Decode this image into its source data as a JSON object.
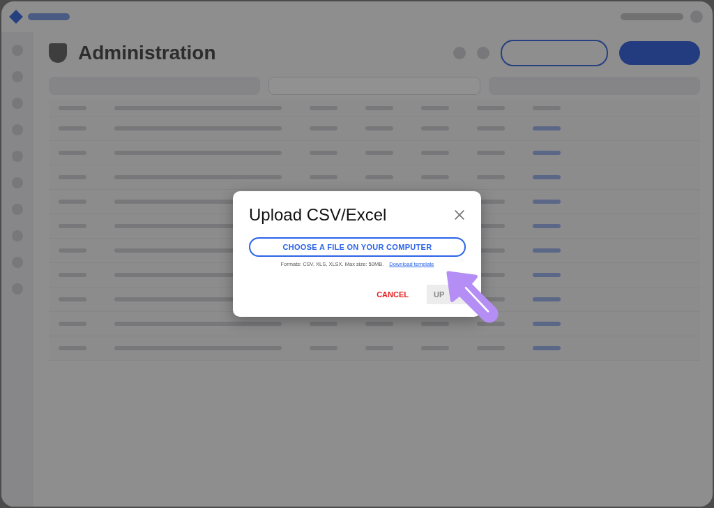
{
  "page": {
    "title": "Administration"
  },
  "tabs": [
    {
      "selected": false
    },
    {
      "selected": true
    },
    {
      "selected": false
    }
  ],
  "dialog": {
    "title": "Upload CSV/Excel",
    "choose_button": "CHOOSE A FILE ON YOUR COMPUTER",
    "formats_note": "Formats: CSV, XLS, XLSX. Max size: 50MB.",
    "template_link": "Download template",
    "actions": [
      {
        "label": "CANCEL",
        "kind": "text",
        "disabled": false
      },
      {
        "label": "UP",
        "kind": "filled",
        "disabled": true
      }
    ]
  }
}
